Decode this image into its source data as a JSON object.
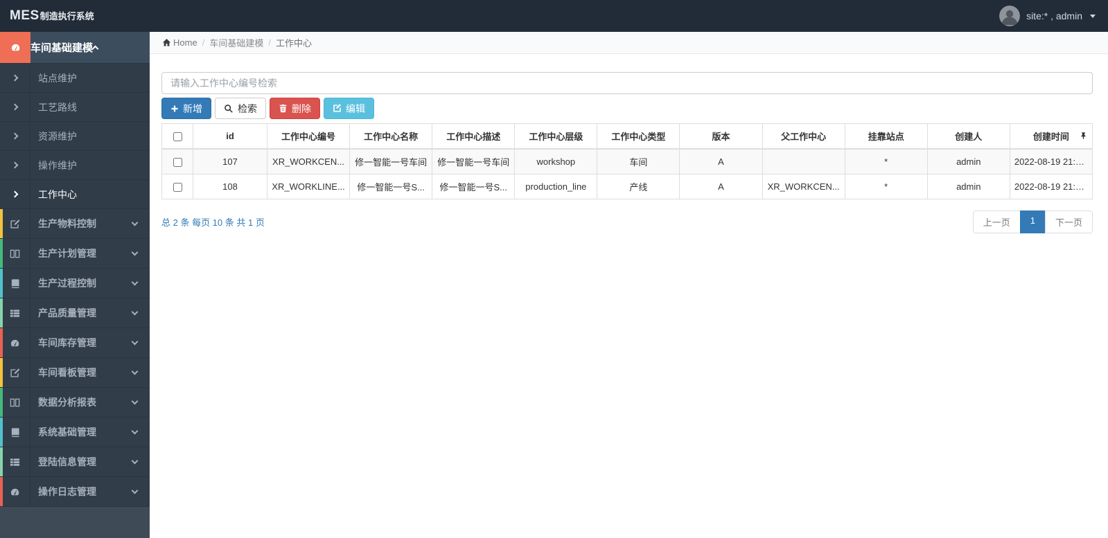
{
  "colors": {
    "navbar_bg": "#222c39",
    "sidebar_bg": "#3e4a56",
    "sidebar_row_bg": "#313d49",
    "active_group_accent": "#ee6e56",
    "primary": "#337ab7",
    "danger": "#d9534f",
    "info": "#5bc0de",
    "link_blue": "#337ab7",
    "pagination_active": "#337ab7",
    "striped_row": "#f9f9f9"
  },
  "navbar": {
    "logo_primary": "MES",
    "logo_secondary": "制造执行系统",
    "user_label": "site:* , admin"
  },
  "sidebar": {
    "active_group": {
      "label": "车间基础建模"
    },
    "sub_items": [
      {
        "label": "站点维护"
      },
      {
        "label": "工艺路线"
      },
      {
        "label": "资源维护"
      },
      {
        "label": "操作维护"
      },
      {
        "label": "工作中心"
      }
    ],
    "groups": [
      {
        "label": "生产物料控制",
        "accent": "#f4c23d"
      },
      {
        "label": "生产计划管理",
        "accent": "#45b97c"
      },
      {
        "label": "生产过程控制",
        "accent": "#52c1ce"
      },
      {
        "label": "产品质量管理",
        "accent": "#86d3ae"
      },
      {
        "label": "车间库存管理",
        "accent": "#ea6153"
      },
      {
        "label": "车间看板管理",
        "accent": "#f4c23d"
      },
      {
        "label": "数据分析报表",
        "accent": "#45b97c"
      },
      {
        "label": "系统基础管理",
        "accent": "#52c1ce"
      },
      {
        "label": "登陆信息管理",
        "accent": "#86d3ae"
      },
      {
        "label": "操作日志管理",
        "accent": "#ea6153"
      }
    ]
  },
  "breadcrumb": {
    "home": "Home",
    "section": "车间基础建模",
    "page": "工作中心"
  },
  "search": {
    "placeholder": "请输入工作中心编号检索",
    "value": ""
  },
  "toolbar": {
    "add_label": "新增",
    "search_label": "检索",
    "delete_label": "删除",
    "edit_label": "编辑"
  },
  "table": {
    "columns": [
      "id",
      "工作中心编号",
      "工作中心名称",
      "工作中心描述",
      "工作中心层级",
      "工作中心类型",
      "版本",
      "父工作中心",
      "挂靠站点",
      "创建人",
      "创建时间"
    ],
    "rows": [
      {
        "cells": [
          "107",
          "XR_WORKCEN...",
          "修一智能一号车间",
          "修一智能一号车间",
          "workshop",
          "车间",
          "A",
          "",
          "*",
          "admin",
          "2022-08-19 21:1..."
        ]
      },
      {
        "cells": [
          "108",
          "XR_WORKLINE...",
          "修一智能一号S...",
          "修一智能一号S...",
          "production_line",
          "产线",
          "A",
          "XR_WORKCEN...",
          "*",
          "admin",
          "2022-08-19 21:1..."
        ]
      }
    ]
  },
  "summary": {
    "text": "总 2 条 每页 10 条 共 1 页"
  },
  "pagination": {
    "prev": "上一页",
    "current": "1",
    "next": "下一页"
  }
}
